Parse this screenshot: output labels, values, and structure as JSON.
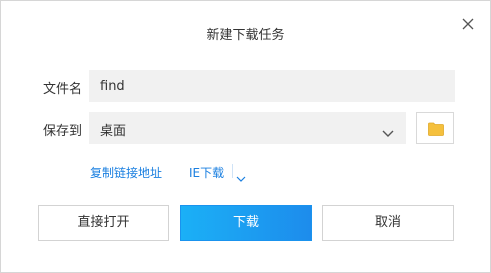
{
  "dialog": {
    "title": "新建下载任务",
    "close_icon": "close-icon"
  },
  "filename": {
    "label": "文件名",
    "value": "find"
  },
  "save_to": {
    "label": "保存到",
    "selected": "桌面",
    "dropdown_icon": "chevron-down-icon",
    "browse_icon": "folder-icon"
  },
  "links": {
    "copy_link": "复制链接地址",
    "ie_download": "IE下载",
    "ie_dropdown_icon": "chevron-down-icon"
  },
  "buttons": {
    "open_direct": "直接打开",
    "download": "下载",
    "cancel": "取消"
  },
  "colors": {
    "primary": "#1d9af0",
    "link": "#1a7fe0",
    "folder": "#f5c03d"
  }
}
